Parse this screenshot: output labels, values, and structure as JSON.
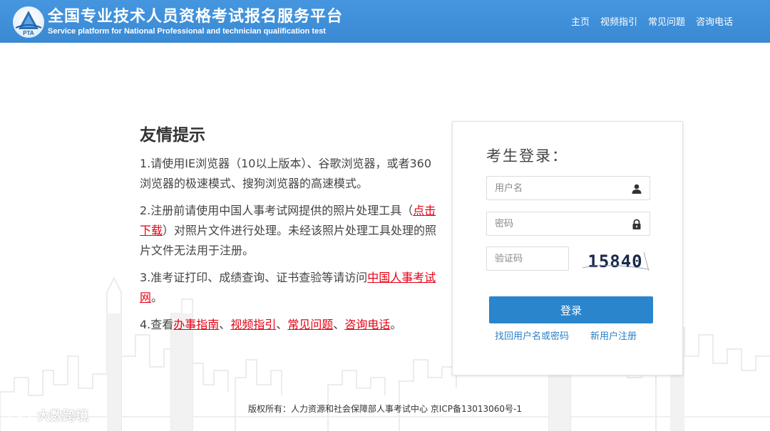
{
  "header": {
    "title": "全国专业技术人员资格考试报名服务平台",
    "subtitle": "Service platform for National Professional and technician qualification test",
    "logo_text": "PTA",
    "nav": [
      "主页",
      "视频指引",
      "常见问题",
      "咨询电话"
    ]
  },
  "tips": {
    "title": "友情提示",
    "items": [
      {
        "text": "1.请使用IE浏览器（10以上版本）、谷歌浏览器，或者360浏览器的极速模式、搜狗浏览器的高速模式。"
      },
      {
        "before": "2.注册前请使用中国人事考试网提供的照片处理工具（",
        "link": "点击下载",
        "after": "）对照片文件进行处理。未经该照片处理工具处理的照片文件无法用于注册。"
      },
      {
        "before": "3.准考证打印、成绩查询、证书查验等请访问",
        "link": "中国人事考试网",
        "after": "。"
      },
      {
        "before": "4.查看",
        "links": [
          "办事指南",
          "视频指引",
          "常见问题",
          "咨询电话"
        ],
        "separator": "、",
        "after": "。"
      }
    ]
  },
  "login": {
    "title": "考生登录：",
    "username_placeholder": "用户名",
    "password_placeholder": "密码",
    "captcha_placeholder": "验证码",
    "captcha_text": "15840",
    "submit_label": "登录",
    "forgot_link": "找回用户名或密码",
    "register_link": "新用户注册"
  },
  "footer": {
    "copyright": "版权所有：人力资源和社会保障部人事考试中心 京ICP备13013060号-1"
  },
  "watermark": {
    "text": "大数跨境"
  },
  "colors": {
    "header_bg": "#3e8fd9",
    "link_red": "#e60012",
    "button_blue": "#2a85cc",
    "link_blue": "#2a7fc8"
  }
}
